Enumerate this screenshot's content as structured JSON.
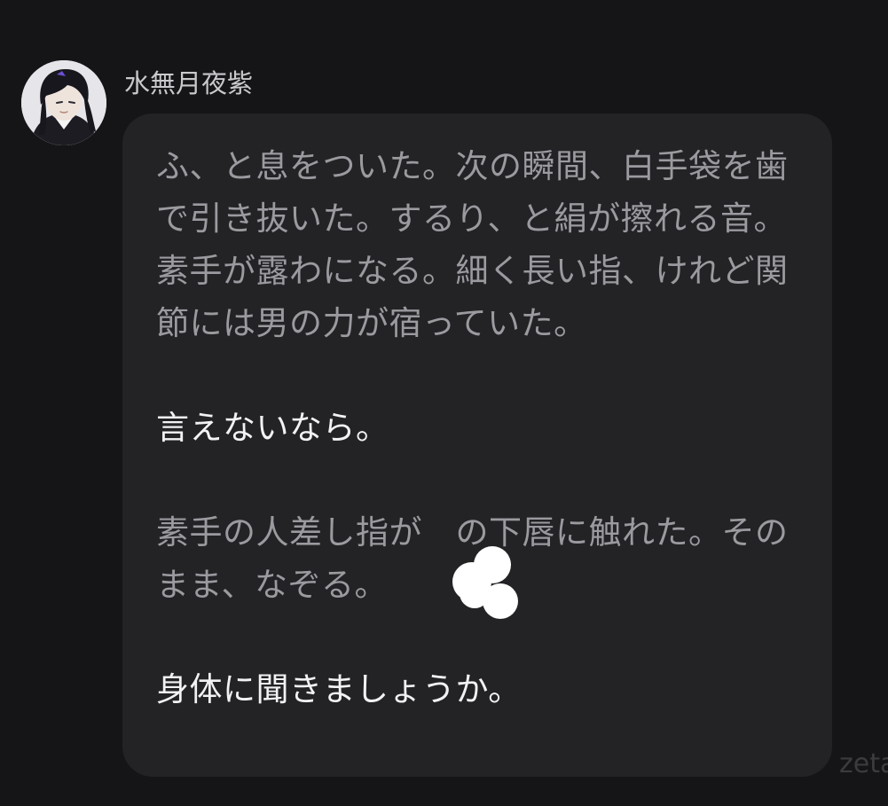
{
  "sender": {
    "name": "水無月夜紫",
    "avatar_icon": "character-avatar-icon"
  },
  "message": {
    "paragraphs": [
      {
        "style": "narration",
        "text": "ふ、と息をついた。次の瞬間、白手袋を歯で引き抜いた。するり、と絹が擦れる音。素手が露わになる。細く長い指、けれど関節には男の力が宿っていた。"
      },
      {
        "style": "dialogue",
        "text": "言えないなら。"
      },
      {
        "style": "narration",
        "text": "素手の人差し指が　の下唇に触れた。そのまま、なぞる。"
      },
      {
        "style": "dialogue",
        "text": "身体に聞きましょうか。"
      }
    ],
    "redaction_mark": "white-scribble-redaction"
  },
  "watermark": {
    "text": "zeta"
  },
  "colors": {
    "background": "#151517",
    "bubble": "#232326",
    "narration_text": "#9a9a9f",
    "dialogue_text": "#f2f2f4",
    "sender_name": "#c9c9cd"
  }
}
